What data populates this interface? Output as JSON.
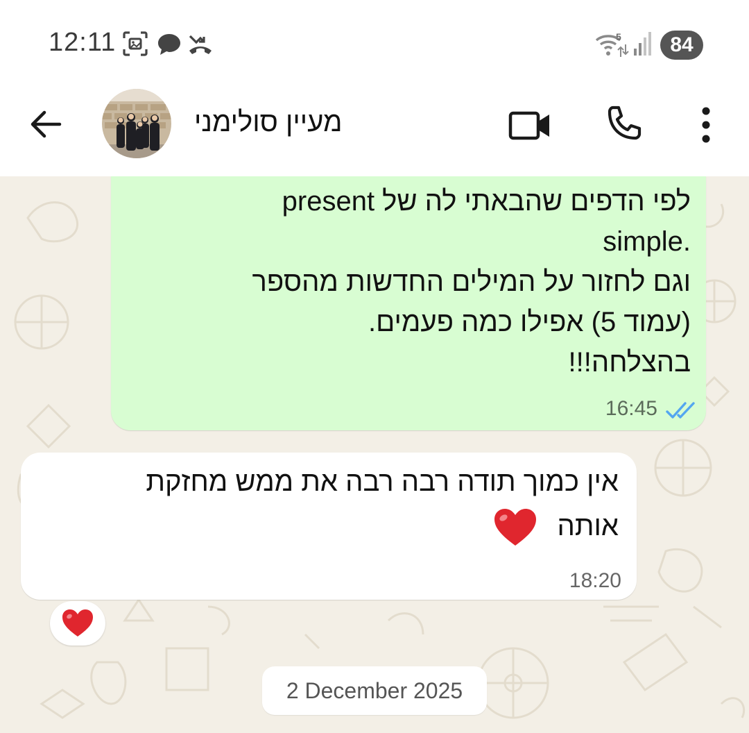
{
  "status_bar": {
    "time": "12:11",
    "battery": "84",
    "icons": [
      "screenshot-icon",
      "chat-bubble-icon",
      "missed-call-icon",
      "wifi-icon",
      "signal-icon",
      "battery-icon"
    ]
  },
  "header": {
    "contact_name": "מעיין סולימני",
    "icons": [
      "back-arrow-icon",
      "video-call-icon",
      "voice-call-icon",
      "more-vert-icon"
    ]
  },
  "messages": [
    {
      "direction": "outgoing",
      "lines": [
        "לפי הדפים שהבאתי לה של present",
        ".simple",
        "וגם לחזור על המילים החדשות מהספר",
        "(עמוד 5) אפילו כמה פעמים.",
        "בהצלחה!!!"
      ],
      "time": "16:45",
      "status": "read"
    },
    {
      "direction": "incoming",
      "lines": [
        "אין כמוך תודה רבה רבה את ממש מחזקת",
        "אותה"
      ],
      "emoji": "red-heart",
      "time": "18:20",
      "reaction": "red-heart"
    }
  ],
  "date_separator": "2 December 2025",
  "colors": {
    "outgoing_bubble": "#d8fdd2",
    "incoming_bubble": "#ffffff",
    "chat_background": "#f3efe6",
    "read_ticks": "#53a6f0",
    "heart": "#e0262e"
  }
}
